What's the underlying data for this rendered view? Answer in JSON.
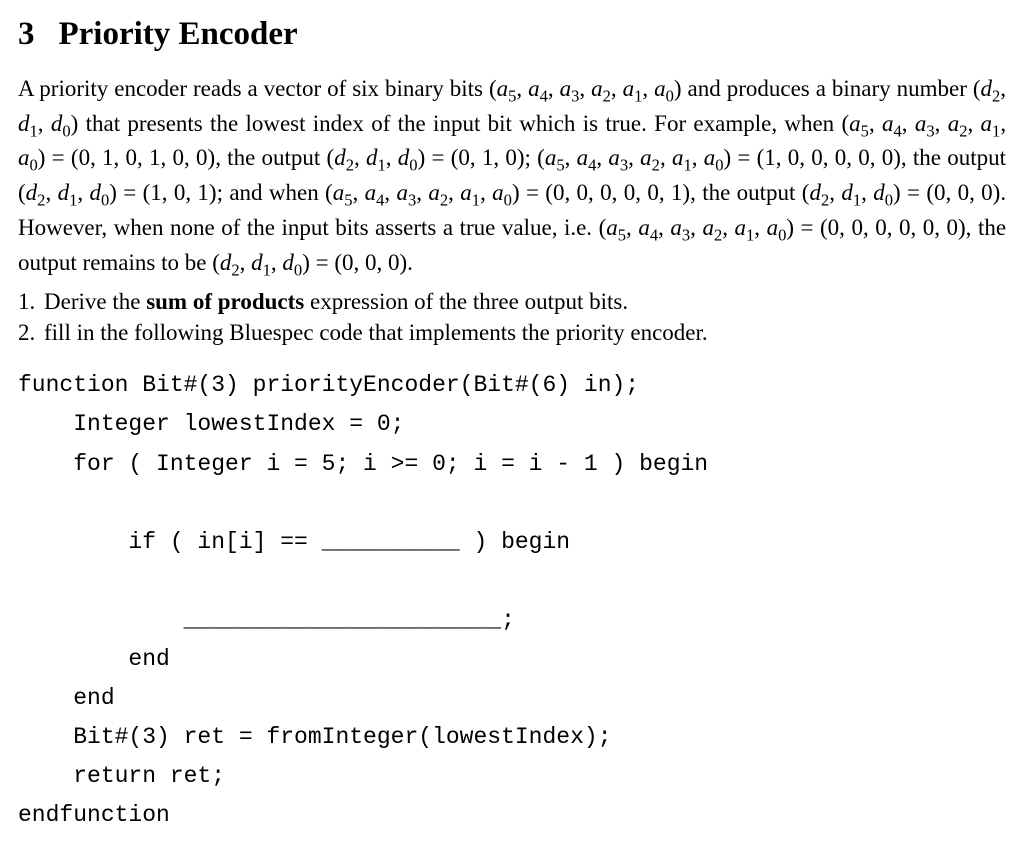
{
  "section": {
    "number": "3",
    "title": "Priority Encoder"
  },
  "para": {
    "s1a": "A priority encoder reads a vector of six binary bits ",
    "s1b": " and produces a binary number ",
    "s1c": " that presents the lowest index of the input bit which is true. For example, when ",
    "s1d": ", the output ",
    "s1e": "; ",
    "s1f": ", the output ",
    "s1g": "; and when ",
    "s1h": ", the output ",
    "s1i": ". However, when none of the input bits asserts a true value, i.e. ",
    "s1j": ", the output remains to be ",
    "s1k": "."
  },
  "math": {
    "avec": "(a5, a4, a3, a2, a1, a0)",
    "dvec": "(d2, d1, d0)",
    "ex1in": "(0, 1, 0, 1, 0, 0)",
    "ex1out": "(0, 1, 0)",
    "ex2in": "(1, 0, 0, 0, 0, 0)",
    "ex2out": "(1, 0, 1)",
    "ex3in": "(0, 0, 0, 0, 0, 1)",
    "ex3out": "(0, 0, 0)",
    "ex4in": "(0, 0, 0, 0, 0, 0)",
    "ex4out": "(0, 0, 0)"
  },
  "tasks": {
    "t1a": "Derive the ",
    "t1b": "sum of products",
    "t1c": " expression of the three output bits.",
    "t2": "fill in the following Bluespec code that implements the priority encoder."
  },
  "code": {
    "l1": "function Bit#(3) priorityEncoder(Bit#(6) in);",
    "l2": "    Integer lowestIndex = 0;",
    "l3": "    for ( Integer i = 5; i >= 0; i = i - 1 ) begin",
    "l4": "",
    "l5": "        if ( in[i] == __________ ) begin",
    "l6": "",
    "l7": "            _______________________;",
    "l8": "        end",
    "l9": "    end",
    "l10": "    Bit#(3) ret = fromInteger(lowestIndex);",
    "l11": "    return ret;",
    "l12": "endfunction"
  }
}
